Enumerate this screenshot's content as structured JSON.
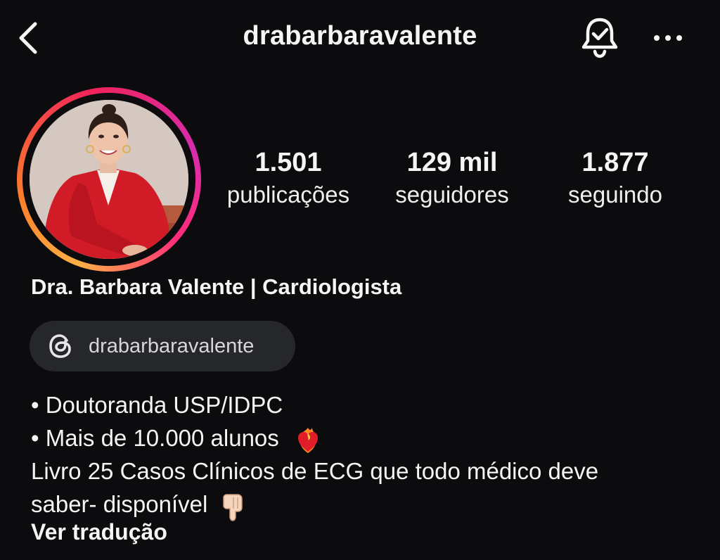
{
  "header": {
    "username": "drabarbaravalente",
    "icons": {
      "back": "chevron-left-icon",
      "notifications": "bell-check-icon",
      "more": "more-horizontal-icon"
    }
  },
  "profile": {
    "avatar_icon": "profile-photo",
    "ring_colors": [
      "#fcb045",
      "#fd7c2a",
      "#f0235b",
      "#d62dac"
    ],
    "stats": [
      {
        "value": "1.501",
        "label": "publicações"
      },
      {
        "value": "129 mil",
        "label": "seguidores"
      },
      {
        "value": "1.877",
        "label": "seguindo"
      }
    ],
    "full_name": "Dra. Barbara Valente | Cardiologista",
    "threads_handle": "drabarbaravalente",
    "threads_icon": "threads-logo-icon"
  },
  "bio": {
    "lines": [
      "• Doutoranda USP/IDPC",
      "• Mais de 10.000 alunos",
      "Livro 25 Casos Clínicos de ECG que todo médico deve",
      "saber- disponível"
    ],
    "emoji_icons": [
      "heart-on-fire-emoji-icon",
      "pointing-down-emoji-icon"
    ],
    "translate_label": "Ver tradução"
  },
  "colors": {
    "background": "#0c0c0f",
    "text": "#f5f5f5",
    "pill_background": "#26272b"
  }
}
